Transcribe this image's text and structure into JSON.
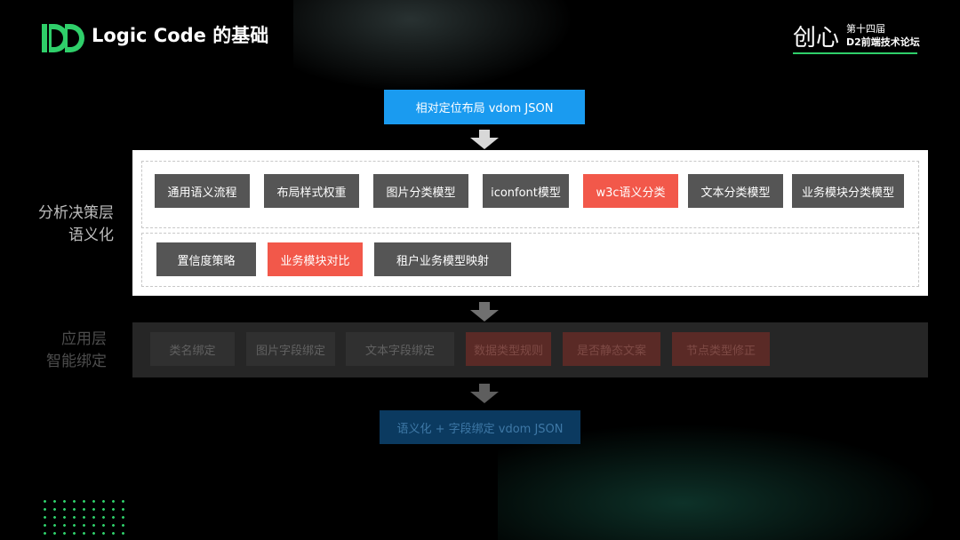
{
  "header": {
    "title": "Logic Code 的基础",
    "brand": {
      "mark": "创心",
      "line1": "第十四届",
      "line2": "D2前端技术论坛"
    }
  },
  "colors": {
    "input_box": "#1a9bf0",
    "highlight": "#f2584a",
    "chip": "#555555",
    "brand_green": "#2fcf6a"
  },
  "flow": {
    "input": "相对定位布局 vdom JSON",
    "analysis_layer": {
      "label_line1": "分析决策层",
      "label_line2": "语义化",
      "row1": [
        "通用语义流程",
        "布局样式权重",
        "图片分类模型",
        "iconfont模型",
        "w3c语义分类",
        "文本分类模型",
        "业务模块分类模型"
      ],
      "row2": [
        "置信度策略",
        "业务模块对比",
        "租户业务模型映射"
      ]
    },
    "app_layer": {
      "label_line1": "应用层",
      "label_line2": "智能绑定",
      "items": [
        "类名绑定",
        "图片字段绑定",
        "文本字段绑定",
        "数据类型规则",
        "是否静态文案",
        "节点类型修正"
      ]
    },
    "output": "语义化 + 字段绑定 vdom JSON"
  }
}
